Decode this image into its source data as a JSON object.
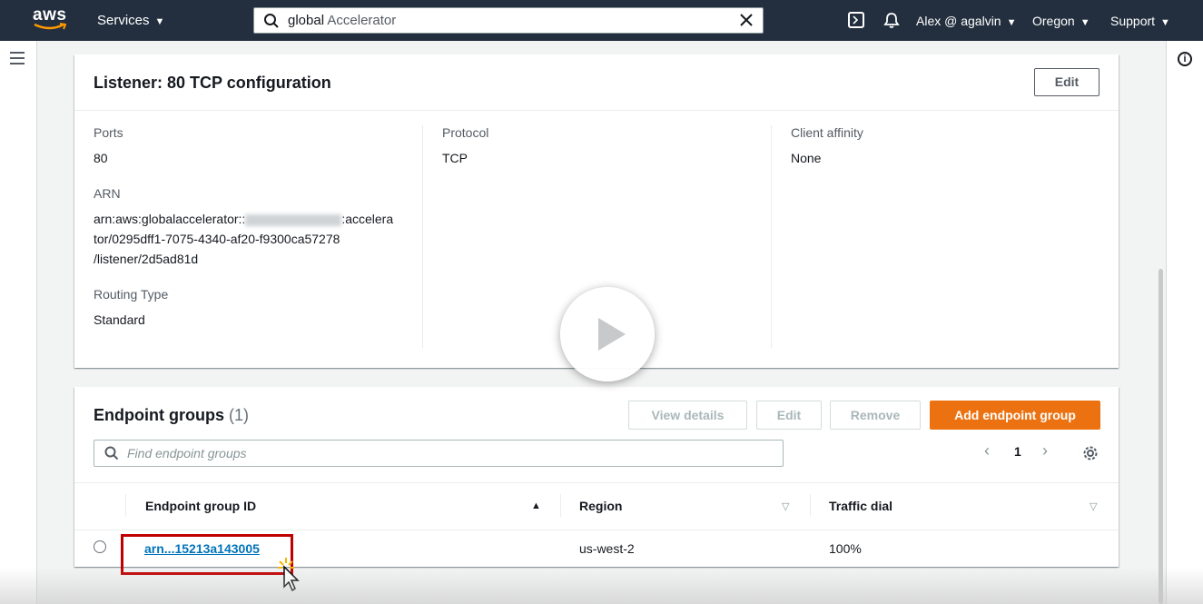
{
  "topnav": {
    "logo": "aws",
    "services": "Services",
    "search_query": "global",
    "search_suffix": " Accelerator",
    "user": "Alex @ agalvin",
    "region": "Oregon",
    "support": "Support"
  },
  "listener": {
    "title": "Listener: 80 TCP configuration",
    "edit": "Edit",
    "ports_label": "Ports",
    "ports_value": "80",
    "arn_label": "ARN",
    "arn_part1": "arn:aws:globalaccelerator::",
    "arn_part2": ":accelera",
    "arn_line2": "tor/0295dff1-7075-4340-af20-f9300ca57278",
    "arn_line3": "/listener/2d5ad81d",
    "routing_label": "Routing Type",
    "routing_value": "Standard",
    "protocol_label": "Protocol",
    "protocol_value": "TCP",
    "affinity_label": "Client affinity",
    "affinity_value": "None"
  },
  "endpoint_groups": {
    "title": "Endpoint groups",
    "count": "(1)",
    "view_details": "View details",
    "edit": "Edit",
    "remove": "Remove",
    "add": "Add endpoint group",
    "search_placeholder": "Find endpoint groups",
    "page": "1",
    "columns": [
      "Endpoint group ID",
      "Region",
      "Traffic dial"
    ],
    "rows": [
      {
        "id": "arn...15213a143005",
        "region": "us-west-2",
        "traffic_dial": "100%"
      }
    ]
  },
  "colors": {
    "nav_bg": "#232f3e",
    "primary": "#ec7211",
    "link": "#0073bb",
    "highlight": "#c00000"
  }
}
